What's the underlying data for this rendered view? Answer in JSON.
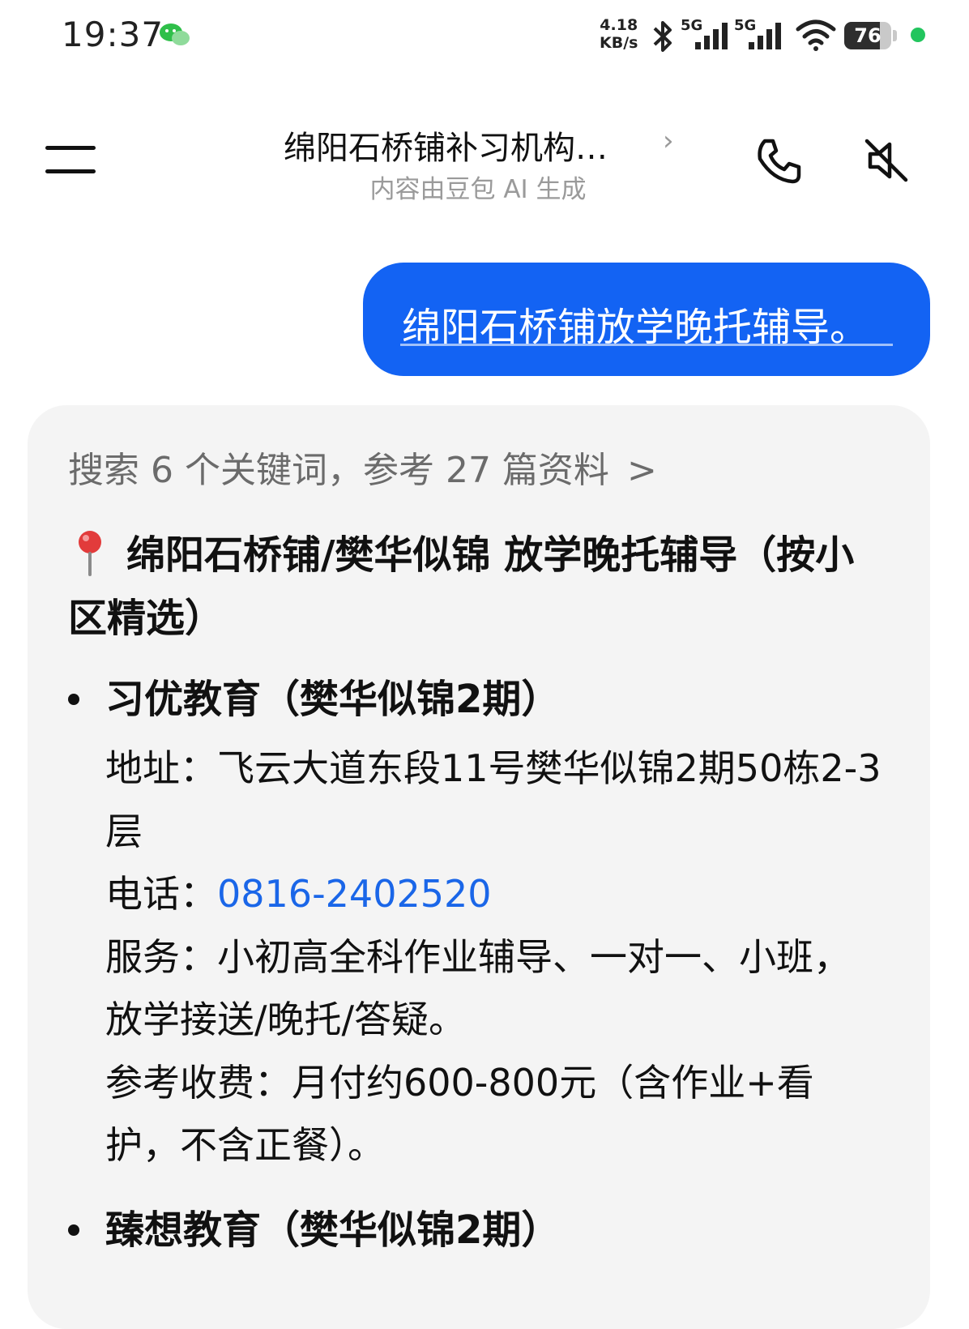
{
  "status_bar": {
    "time": "19:37",
    "net_speed_value": "4.18",
    "net_speed_unit": "KB/s",
    "sim1_label": "5G",
    "sim2_label": "5G",
    "battery_percent": "76",
    "battery_level": 0.76,
    "icons": [
      "wechat-icon",
      "bluetooth-icon",
      "signal-icon",
      "signal-icon",
      "wifi-icon",
      "battery-icon"
    ]
  },
  "header": {
    "title": "绵阳石桥铺补习机构…",
    "subtitle": "内容由豆包 AI 生成",
    "chevron": "›"
  },
  "user_message": {
    "text": "绵阳石桥铺放学晚托辅导。"
  },
  "answer": {
    "search_summary": "搜索 6 个关键词，参考 27 篇资料",
    "search_chevron": ">",
    "heading": "绵阳石桥铺/樊华似锦 放学晚托辅导（按小区精选）",
    "entries": [
      {
        "title": "习优教育（樊华似锦2期）",
        "address_label": "地址：",
        "address": "飞云大道东段11号樊华似锦2期50栋2-3层",
        "phone_label": "电话：",
        "phone": "0816-2402520",
        "services_label": "服务：",
        "services": "小初高全科作业辅导、一对一、小班，放学接送/晚托/答疑。",
        "fee_label": "参考收费：",
        "fee": "月付约600-800元（含作业+看护，不含正餐）。"
      },
      {
        "title": "臻想教育（樊华似锦2期）"
      }
    ]
  },
  "colors": {
    "accent_blue": "#1363f3",
    "link_blue": "#1a66e8",
    "card_bg": "#f4f4f4",
    "status_dot": "#22c55e"
  }
}
